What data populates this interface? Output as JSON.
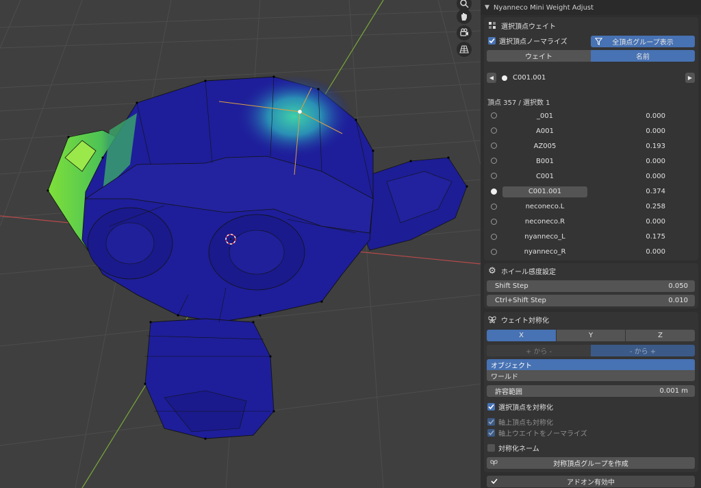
{
  "panel": {
    "header_title": "Nyanneco Mini Weight Adjust",
    "selected_vertex_weight": {
      "section_title": "選択頂点ウェイト",
      "normalize_label": "選択頂点ノーマライズ",
      "normalize_checked": true,
      "show_all_groups_label": "全頂点グループ表示",
      "tabs": [
        {
          "label": "ウェイト",
          "active": false
        },
        {
          "label": "名前",
          "active": true
        }
      ],
      "current_group": "C001.001",
      "vertex_info": "頂点 357 / 選択数 1",
      "groups": [
        {
          "name": "_001",
          "value": "0.000",
          "active": false
        },
        {
          "name": "A001",
          "value": "0.000",
          "active": false
        },
        {
          "name": "AZ005",
          "value": "0.193",
          "active": false
        },
        {
          "name": "B001",
          "value": "0.000",
          "active": false
        },
        {
          "name": "C001",
          "value": "0.000",
          "active": false
        },
        {
          "name": "C001.001",
          "value": "0.374",
          "active": true
        },
        {
          "name": "neconeco.L",
          "value": "0.258",
          "active": false
        },
        {
          "name": "neconeco.R",
          "value": "0.000",
          "active": false
        },
        {
          "name": "nyanneco_L",
          "value": "0.175",
          "active": false
        },
        {
          "name": "nyanneco_R",
          "value": "0.000",
          "active": false
        }
      ]
    },
    "wheel": {
      "section_title": "ホイール感度設定",
      "shift_label": "Shift Step",
      "shift_value": "0.050",
      "ctrl_shift_label": "Ctrl+Shift Step",
      "ctrl_shift_value": "0.010"
    },
    "symmetry": {
      "section_title": "ウェイト対称化",
      "axes": [
        {
          "label": "X",
          "active": true
        },
        {
          "label": "Y",
          "active": false
        },
        {
          "label": "Z",
          "active": false
        }
      ],
      "direction": [
        {
          "label": "+ から -",
          "active": false
        },
        {
          "label": "- から +",
          "active": true
        }
      ],
      "space_options": [
        {
          "label": "オブジェクト",
          "active": true
        },
        {
          "label": "ワールド",
          "active": false
        }
      ],
      "tolerance_label": "許容範囲",
      "tolerance_value": "0.001 m",
      "symmetrize_selected_label": "選択頂点を対称化",
      "symmetrize_selected_checked": true,
      "axis_vertices_label": "軸上頂点も対称化",
      "axis_vertices_checked": true,
      "normalize_axis_label": "軸上ウエイトをノーマライズ",
      "normalize_axis_checked": true,
      "symmetric_name_label": "対称化ネーム",
      "symmetric_name_checked": false,
      "create_groups_label": "対称頂点グループを作成",
      "addon_enabled_label": "アドオン有効中"
    }
  },
  "viewport": {
    "nav_icons": [
      "zoom-icon",
      "hand-pan-icon",
      "camera-view-icon",
      "grid-perspective-icon"
    ],
    "colors": {
      "background": "#3f3f3f",
      "mesh_blue": "#1e1e9a",
      "weight_green": "#6ed23c",
      "weight_teal": "#21b8a8",
      "accent": "#4772b3"
    }
  }
}
